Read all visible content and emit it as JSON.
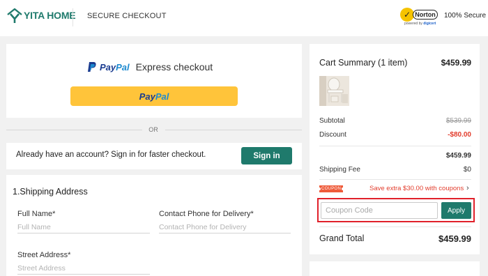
{
  "header": {
    "brand": "YITA HOME",
    "title": "SECURE CHECKOUT",
    "norton_word": "Norton",
    "norton_sub_prefix": "powered by ",
    "norton_sub_brand": "digicert",
    "secure_label": "100% Secure"
  },
  "paypal": {
    "brand_pay": "Pay",
    "brand_pal": "Pal",
    "express_text": "Express checkout",
    "button_pay": "Pay",
    "button_pal": "Pal"
  },
  "divider": {
    "or": "OR"
  },
  "signin": {
    "text": "Already have an account? Sign in for faster checkout.",
    "button": "Sign in"
  },
  "shipping": {
    "title": "1.Shipping Address",
    "full_name_label": "Full Name*",
    "full_name_placeholder": "Full Name",
    "phone_label": "Contact Phone for Delivery*",
    "phone_placeholder": "Contact Phone for Delivery",
    "street_label": "Street Address*",
    "street_placeholder": "Street Address"
  },
  "cart": {
    "title": "Cart Summary (1 item)",
    "total_top": "$459.99",
    "subtotal_label": "Subtotal",
    "subtotal_value": "$539.99",
    "discount_label": "Discount",
    "discount_value": "-$80.00",
    "after_discount_value": "$459.99",
    "shipping_label": "Shipping Fee",
    "shipping_value": "$0",
    "coupon_tag": "COUPON",
    "coupon_offer": "Save extra $30.00 with coupons",
    "coupon_placeholder": "Coupon Code",
    "apply_button": "Apply",
    "grand_total_label": "Grand Total",
    "grand_total_value": "$459.99"
  },
  "colors": {
    "brand_green": "#1f7a6c",
    "paypal_yellow": "#ffc43a",
    "discount_red": "#e23c2c",
    "coupon_highlight": "#e0202a"
  }
}
